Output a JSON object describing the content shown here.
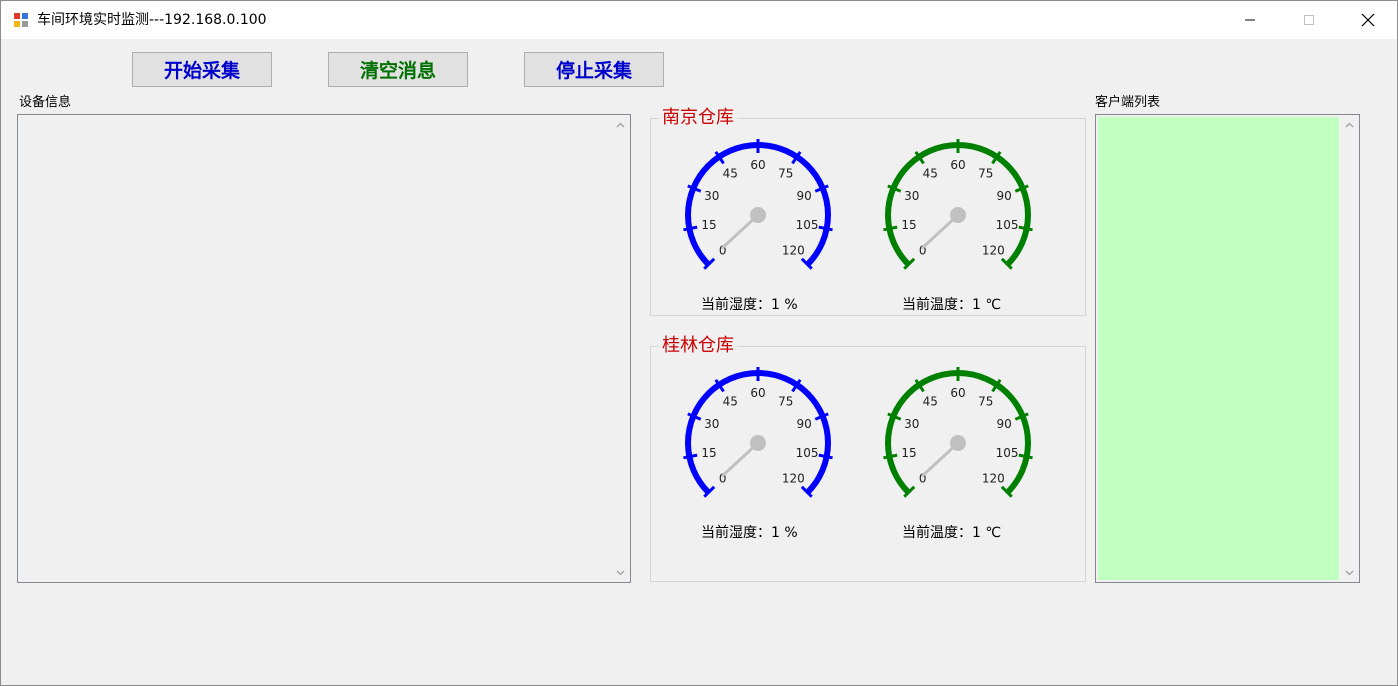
{
  "window": {
    "title": "车间环境实时监测---192.168.0.100",
    "controls": {
      "minimize": "minimize-icon",
      "maximize": "maximize-icon",
      "close": "close-icon"
    }
  },
  "toolbar": {
    "start_label": "开始采集",
    "clear_label": "清空消息",
    "stop_label": "停止采集",
    "start_color": "#0000cc",
    "clear_color": "#007000",
    "stop_color": "#0000cc"
  },
  "device_panel": {
    "label": "设备信息",
    "items": []
  },
  "client_panel": {
    "label": "客户端列表",
    "items": [],
    "background": "#c0ffc0"
  },
  "warehouses": [
    {
      "name": "南京仓库",
      "humidity": {
        "ticks": [
          "0",
          "15",
          "30",
          "45",
          "60",
          "75",
          "90",
          "105",
          "120"
        ],
        "value": 1,
        "color": "#0000ff",
        "readout": "当前湿度：1 %"
      },
      "temperature": {
        "ticks": [
          "0",
          "15",
          "30",
          "45",
          "60",
          "75",
          "90",
          "105",
          "120"
        ],
        "value": 1,
        "color": "#008000",
        "readout": "当前温度：1 ℃"
      }
    },
    {
      "name": "桂林仓库",
      "humidity": {
        "ticks": [
          "0",
          "15",
          "30",
          "45",
          "60",
          "75",
          "90",
          "105",
          "120"
        ],
        "value": 1,
        "color": "#0000ff",
        "readout": "当前湿度：1 %"
      },
      "temperature": {
        "ticks": [
          "0",
          "15",
          "30",
          "45",
          "60",
          "75",
          "90",
          "105",
          "120"
        ],
        "value": 1,
        "color": "#008000",
        "readout": "当前温度：1 ℃"
      }
    }
  ]
}
